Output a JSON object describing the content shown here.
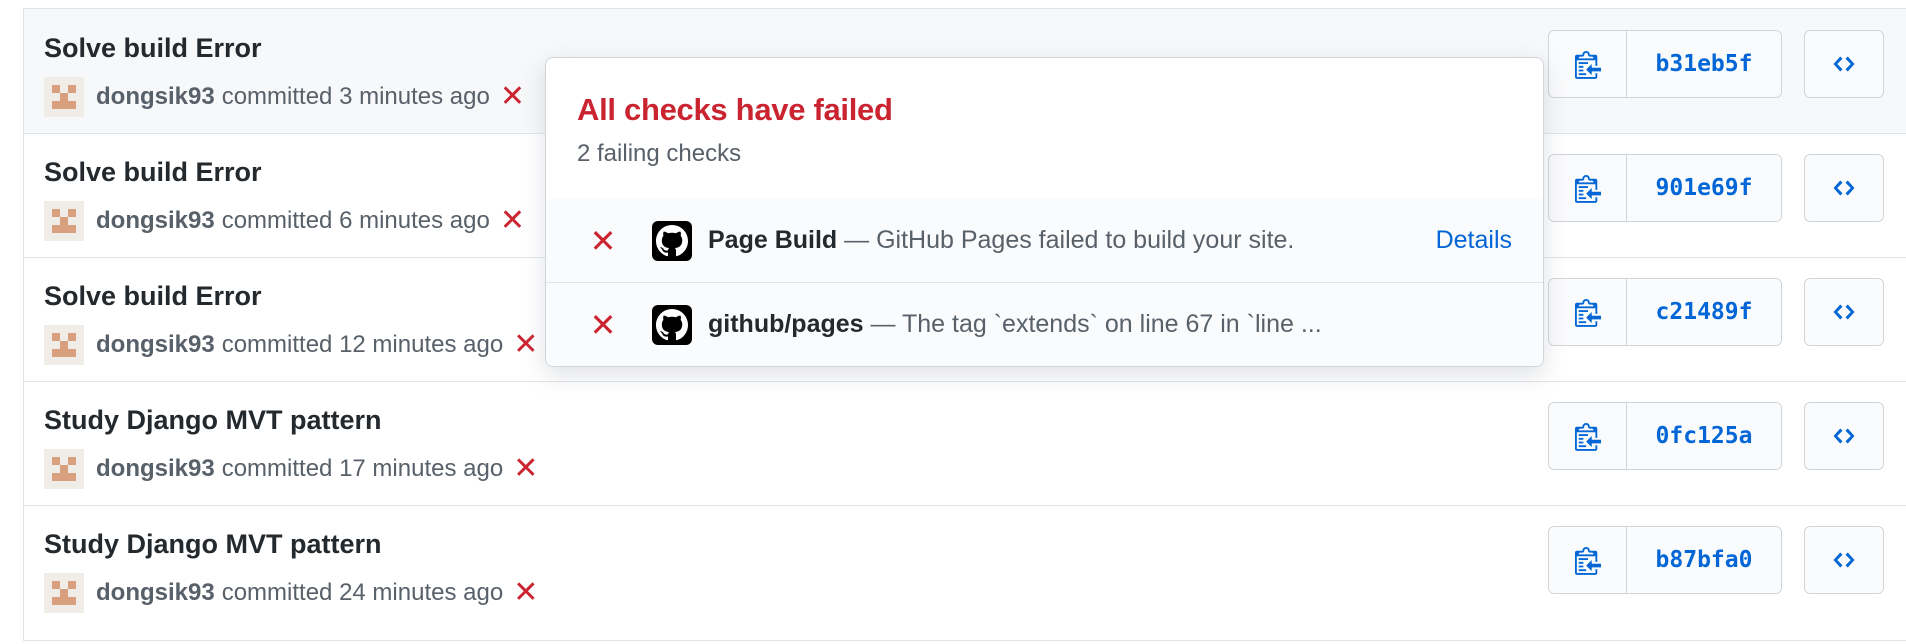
{
  "colors": {
    "fail": "#cb2431",
    "link": "#0366d6",
    "text": "#24292e",
    "muted": "#586069"
  },
  "commits": [
    {
      "title": "Solve build Error",
      "author": "dongsik93",
      "time": "committed 3 minutes ago",
      "sha": "b31eb5f",
      "status": "failed"
    },
    {
      "title": "Solve build Error",
      "author": "dongsik93",
      "time": "committed 6 minutes ago",
      "sha": "901e69f",
      "status": "failed"
    },
    {
      "title": "Solve build Error",
      "author": "dongsik93",
      "time": "committed 12 minutes ago",
      "sha": "c21489f",
      "status": "failed"
    },
    {
      "title": "Study Django MVT pattern",
      "author": "dongsik93",
      "time": "committed 17 minutes ago",
      "sha": "0fc125a",
      "status": "failed"
    },
    {
      "title": "Study Django MVT pattern",
      "author": "dongsik93",
      "time": "committed 24 minutes ago",
      "sha": "b87bfa0",
      "status": "failed"
    }
  ],
  "icons": {
    "status": "x-icon",
    "copy": "clipboard-copy-icon",
    "browse": "code-icon",
    "check_app": "github-logo-icon"
  },
  "popover": {
    "title": "All checks have failed",
    "subtitle": "2 failing checks",
    "checks": [
      {
        "name": "Page Build",
        "description": " — GitHub Pages failed to build your site.",
        "link": "Details"
      },
      {
        "name": "github/pages",
        "description": " — The tag `extends` on line 67 in `line ...",
        "link": ""
      }
    ]
  }
}
